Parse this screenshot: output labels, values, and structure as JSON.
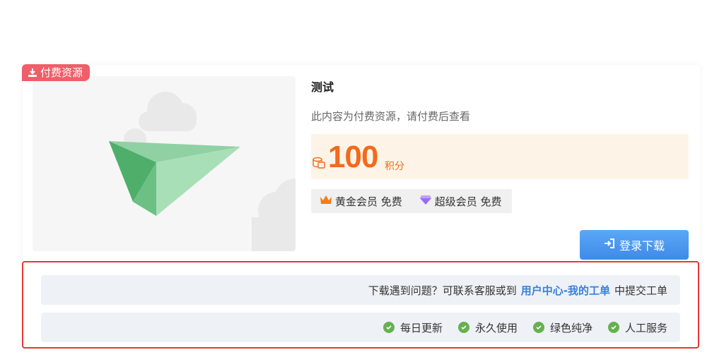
{
  "ribbon": {
    "label": "付费资源",
    "icon": "download-icon",
    "color": "#ee5f6a"
  },
  "resource": {
    "title": "测试",
    "description": "此内容为付费资源，请付费后查看",
    "price": {
      "amount": "100",
      "unit": "积分",
      "icon": "coins-icon",
      "color": "#f26a1b"
    }
  },
  "vip": [
    {
      "label": "黄金会员 免费",
      "icon": "crown-icon"
    },
    {
      "label": "超级会员 免费",
      "icon": "diamond-icon"
    }
  ],
  "login_button": {
    "label": "登录下载",
    "icon": "login-icon"
  },
  "help": {
    "prefix": "下载遇到问题？可联系客服或到",
    "link": "用户中心-我的工单",
    "suffix": "中提交工单"
  },
  "features": [
    {
      "label": "每日更新"
    },
    {
      "label": "永久使用"
    },
    {
      "label": "绿色纯净"
    },
    {
      "label": "人工服务"
    }
  ],
  "colors": {
    "accent": "#3f8ae8",
    "highlight_border": "#e53935",
    "check": "#67b04f"
  }
}
